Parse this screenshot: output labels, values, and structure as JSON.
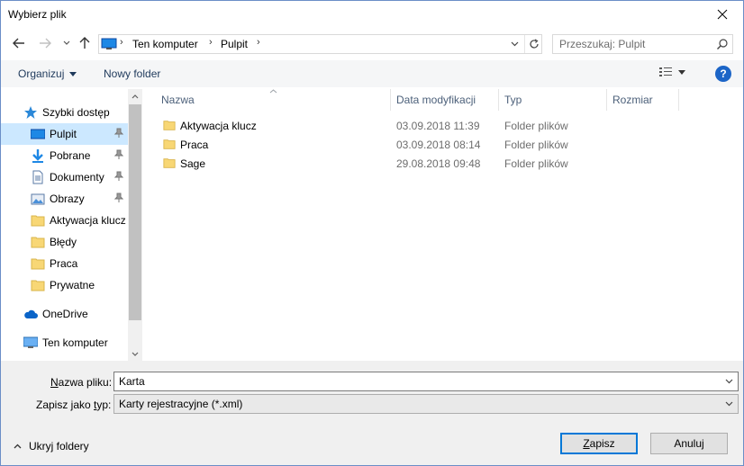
{
  "window": {
    "title": "Wybierz plik"
  },
  "address": {
    "crumbs": [
      "Ten komputer",
      "Pulpit"
    ],
    "search_placeholder": "Przeszukaj: Pulpit"
  },
  "toolbar": {
    "organize": "Organizuj",
    "new_folder": "Nowy folder"
  },
  "nav": {
    "quick_access": "Szybki dostęp",
    "items": [
      {
        "label": "Pulpit",
        "icon": "desktop-icon",
        "pinned": true,
        "selected": true
      },
      {
        "label": "Pobrane",
        "icon": "download-icon",
        "pinned": true
      },
      {
        "label": "Dokumenty",
        "icon": "documents-icon",
        "pinned": true
      },
      {
        "label": "Obrazy",
        "icon": "pictures-icon",
        "pinned": true
      },
      {
        "label": "Aktywacja klucz",
        "icon": "folder-icon"
      },
      {
        "label": "Błędy",
        "icon": "folder-icon"
      },
      {
        "label": "Praca",
        "icon": "folder-icon"
      },
      {
        "label": "Prywatne",
        "icon": "folder-icon"
      }
    ],
    "onedrive": "OneDrive",
    "this_pc": "Ten komputer"
  },
  "columns": {
    "name": "Nazwa",
    "modified": "Data modyfikacji",
    "type": "Typ",
    "size": "Rozmiar"
  },
  "files": [
    {
      "name": "Aktywacja klucz",
      "modified": "03.09.2018 11:39",
      "type": "Folder plików"
    },
    {
      "name": "Praca",
      "modified": "03.09.2018 08:14",
      "type": "Folder plików"
    },
    {
      "name": "Sage",
      "modified": "29.08.2018 09:48",
      "type": "Folder plików"
    }
  ],
  "form": {
    "filename_label_u": "N",
    "filename_label_rest": "azwa pliku:",
    "filename_value": "Karta",
    "type_label_pre": "Zapisz jako ",
    "type_label_u": "t",
    "type_label_post": "yp:",
    "type_value": "Karty rejestracyjne (*.xml)"
  },
  "footer": {
    "hide_folders": "Ukryj foldery",
    "save_u": "Z",
    "save_rest": "apisz",
    "cancel": "Anuluj"
  },
  "colors": {
    "selection": "#cce8ff",
    "folder": "#f8d775",
    "accent": "#0078d7"
  }
}
